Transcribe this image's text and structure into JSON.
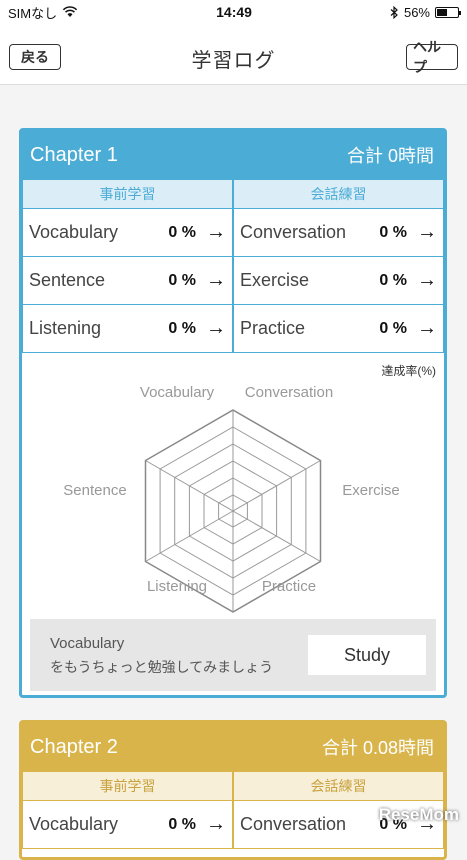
{
  "status": {
    "carrier": "SIMなし",
    "time": "14:49",
    "battery": "56%",
    "battery_level": 0.56
  },
  "nav": {
    "back": "戻る",
    "title": "学習ログ",
    "help": "ヘルプ"
  },
  "chapters": [
    {
      "title": "Chapter 1",
      "total": "合計 0時間",
      "col_left": "事前学習",
      "col_right": "会話練習",
      "left": [
        {
          "name": "Vocabulary",
          "pct": "0 %"
        },
        {
          "name": "Sentence",
          "pct": "0 %"
        },
        {
          "name": "Listening",
          "pct": "0 %"
        }
      ],
      "right": [
        {
          "name": "Conversation",
          "pct": "0 %"
        },
        {
          "name": "Exercise",
          "pct": "0 %"
        },
        {
          "name": "Practice",
          "pct": "0 %"
        }
      ],
      "rate_label": "達成率(%)",
      "radar_labels": {
        "vocabulary": "Vocabulary",
        "conversation": "Conversation",
        "exercise": "Exercise",
        "practice": "Practice",
        "listening": "Listening",
        "sentence": "Sentence"
      },
      "advice_title": "Vocabulary",
      "advice_text": "をもうちょっと勉強してみましょう",
      "study": "Study"
    },
    {
      "title": "Chapter 2",
      "total": "合計 0.08時間",
      "col_left": "事前学習",
      "col_right": "会話練習",
      "left": [
        {
          "name": "Vocabulary",
          "pct": "0 %"
        }
      ],
      "right": [
        {
          "name": "Conversation",
          "pct": "0 %"
        }
      ]
    }
  ],
  "arrow": "→",
  "watermark": "ReseMom"
}
